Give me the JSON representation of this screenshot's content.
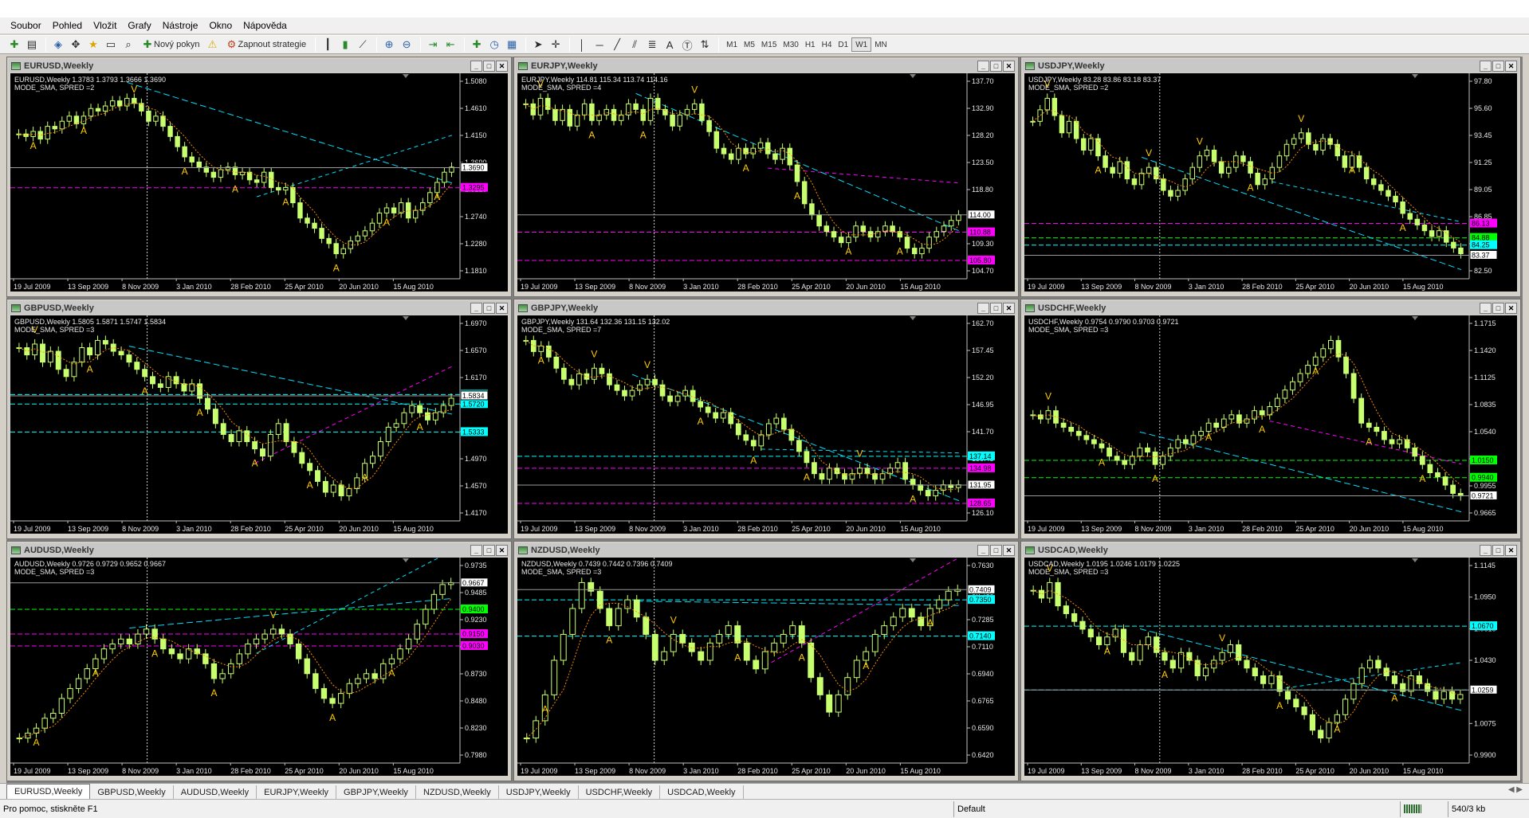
{
  "menu": [
    "Soubor",
    "Pohled",
    "Vložit",
    "Grafy",
    "Nástroje",
    "Okno",
    "Nápověda"
  ],
  "toolbar": {
    "new_order_label": "Nový pokyn",
    "strategy_label": "Zapnout strategie",
    "timeframes": [
      "M1",
      "M5",
      "M15",
      "M30",
      "H1",
      "H4",
      "D1",
      "W1",
      "MN"
    ],
    "active_timeframe": "W1"
  },
  "x_axis_dates": [
    "19 Jul 2009",
    "13 Sep 2009",
    "8 Nov 2009",
    "3 Jan 2010",
    "28 Feb 2010",
    "25 Apr 2010",
    "20 Jun 2010",
    "15 Aug 2010"
  ],
  "windows": [
    {
      "id": "eurusd",
      "title": "EURUSD,Weekly",
      "info1": "EURUSD,Weekly  1.3783 1.3793 1.3666 1.3690",
      "info2": "MODE_SMA, SPRED =2",
      "price_labels": [
        "1.5080",
        "1.4610",
        "1.4150",
        "1.3690",
        "1.3210",
        "1.2740",
        "1.2280",
        "1.1810"
      ],
      "current_price": "1.3690",
      "marker_labels": [
        "1.3295"
      ],
      "marker_colors": [
        "#ff00ff"
      ],
      "series": [
        1.435,
        1.43,
        1.44,
        1.425,
        1.45,
        1.445,
        1.46,
        1.47,
        1.455,
        1.47,
        1.485,
        1.48,
        1.49,
        1.5,
        1.49,
        1.505,
        1.495,
        1.48,
        1.46,
        1.47,
        1.45,
        1.43,
        1.41,
        1.39,
        1.38,
        1.37,
        1.36,
        1.35,
        1.365,
        1.37,
        1.355,
        1.36,
        1.345,
        1.34,
        1.36,
        1.33,
        1.325,
        1.33,
        1.3,
        1.27,
        1.26,
        1.25,
        1.23,
        1.22,
        1.2,
        1.21,
        1.225,
        1.235,
        1.245,
        1.26,
        1.28,
        1.29,
        1.28,
        1.3,
        1.27,
        1.285,
        1.3,
        1.32,
        1.34,
        1.36,
        1.37
      ]
    },
    {
      "id": "eurjpy",
      "title": "EURJPY,Weekly",
      "info1": "EURJPY,Weekly  114.81 115.34 113.74 114.16",
      "info2": "MODE_SMA, SPRED =4",
      "price_labels": [
        "137.70",
        "132.90",
        "128.20",
        "123.50",
        "118.80",
        "114.00",
        "109.30",
        "104.70"
      ],
      "current_price": "114.00",
      "marker_labels": [
        "110.88",
        "105.80"
      ],
      "marker_colors": [
        "#ff00ff",
        "#ff00ff"
      ],
      "series": [
        134,
        132,
        135,
        133,
        131,
        133,
        130,
        132,
        134,
        131,
        132,
        133,
        131,
        132,
        134,
        133,
        131,
        135,
        133,
        132,
        130,
        132,
        133,
        134,
        131,
        129,
        126,
        125,
        124,
        126,
        125,
        126,
        127,
        125,
        124,
        126,
        123,
        120,
        116,
        114,
        112,
        111,
        110,
        109,
        110,
        112,
        111,
        110,
        111,
        112,
        111,
        110,
        108,
        107,
        108,
        110,
        111,
        112,
        113,
        114
      ]
    },
    {
      "id": "usdjpy",
      "title": "USDJPY,Weekly",
      "info1": "USDJPY,Weekly  83.28 83.86 83.18 83.37",
      "info2": "MODE_SMA, SPRED =2",
      "price_labels": [
        "97.80",
        "95.60",
        "93.45",
        "91.25",
        "89.05",
        "86.85",
        "84.70",
        "82.50"
      ],
      "current_price": "83.37",
      "marker_labels": [
        "86.13",
        "84.88",
        "84.25"
      ],
      "marker_colors": [
        "#ff00ff",
        "#00ff00",
        "#00ffff"
      ],
      "series": [
        95,
        96,
        97,
        95.5,
        94,
        95,
        93.5,
        92.5,
        93.5,
        92,
        91,
        90.5,
        91.5,
        90,
        89.5,
        90.5,
        91,
        90,
        89,
        88.5,
        89,
        90,
        91,
        92,
        92.5,
        91.5,
        90.5,
        91,
        92,
        91.5,
        90.5,
        89.5,
        90,
        91,
        92,
        93,
        93.5,
        94,
        93,
        92.5,
        93.5,
        93,
        92,
        91,
        92,
        91,
        90,
        89.5,
        89,
        88.5,
        88,
        87,
        86.5,
        86,
        85.5,
        85,
        85.5,
        84.5,
        84,
        83.5
      ]
    },
    {
      "id": "gbpusd",
      "title": "GBPUSD,Weekly",
      "info1": "GBPUSD,Weekly  1.5805 1.5871 1.5747 1.5834",
      "info2": "MODE_SMA, SPRED =3",
      "price_labels": [
        "1.6970",
        "1.6570",
        "1.6170",
        "1.5770",
        "1.5370",
        "1.4970",
        "1.4570",
        "1.4170"
      ],
      "current_price": "1.5834",
      "marker_labels": [
        "1.5834",
        "1.5851",
        "1.5720",
        "1.5333"
      ],
      "marker_colors": [
        "#00ffff",
        "#00ffff",
        "#00ffff",
        "#00ffff"
      ],
      "series": [
        1.65,
        1.64,
        1.655,
        1.63,
        1.645,
        1.62,
        1.61,
        1.63,
        1.65,
        1.64,
        1.66,
        1.655,
        1.645,
        1.64,
        1.63,
        1.62,
        1.61,
        1.6,
        1.595,
        1.61,
        1.6,
        1.59,
        1.6,
        1.58,
        1.565,
        1.545,
        1.53,
        1.52,
        1.535,
        1.52,
        1.51,
        1.5,
        1.53,
        1.545,
        1.52,
        1.505,
        1.49,
        1.48,
        1.465,
        1.45,
        1.46,
        1.445,
        1.455,
        1.47,
        1.49,
        1.5,
        1.52,
        1.54,
        1.545,
        1.56,
        1.57,
        1.56,
        1.55,
        1.56,
        1.57,
        1.58
      ]
    },
    {
      "id": "gbpjpy",
      "title": "GBPJPY,Weekly",
      "info1": "GBPJPY,Weekly  131.64 132.36 131.15 132.02",
      "info2": "MODE_SMA, SPRED =7",
      "price_labels": [
        "162.70",
        "157.45",
        "152.20",
        "146.95",
        "141.70",
        "136.45",
        "131.20",
        "126.10"
      ],
      "current_price": "131.95",
      "marker_labels": [
        "137.14",
        "134.98",
        "131.95",
        "128.65"
      ],
      "marker_colors": [
        "#00ffff",
        "#ff00ff",
        "#00ffff",
        "#ff00ff"
      ],
      "series": [
        158,
        156,
        157,
        155,
        153,
        151,
        150,
        152,
        151,
        153,
        152,
        150,
        149,
        148,
        149,
        150,
        151,
        150,
        148,
        147,
        148,
        149,
        147,
        146,
        145,
        144,
        145,
        143,
        141,
        140,
        139,
        141,
        143,
        144,
        142,
        140,
        138,
        136,
        134,
        133,
        135,
        134,
        133,
        134,
        135,
        134,
        133,
        134,
        135,
        136,
        133,
        132,
        131,
        130,
        131,
        132,
        131.5,
        132
      ]
    },
    {
      "id": "usdchf",
      "title": "USDCHF,Weekly",
      "info1": "USDCHF,Weekly  0.9754 0.9790 0.9703 0.9721",
      "info2": "MODE_SMA, SPRED =3",
      "price_labels": [
        "1.1715",
        "1.1420",
        "1.1125",
        "1.0835",
        "1.0540",
        "1.0250",
        "0.9955",
        "0.9665"
      ],
      "current_price": "0.9721",
      "marker_labels": [
        "1.0150",
        "0.9940"
      ],
      "marker_colors": [
        "#00ff00",
        "#00ff00"
      ],
      "series": [
        1.07,
        1.065,
        1.075,
        1.06,
        1.055,
        1.05,
        1.045,
        1.04,
        1.035,
        1.03,
        1.02,
        1.015,
        1.01,
        1.02,
        1.03,
        1.025,
        1.01,
        1.02,
        1.03,
        1.04,
        1.035,
        1.045,
        1.05,
        1.06,
        1.055,
        1.065,
        1.07,
        1.06,
        1.065,
        1.075,
        1.07,
        1.08,
        1.09,
        1.1,
        1.11,
        1.12,
        1.13,
        1.14,
        1.15,
        1.16,
        1.14,
        1.12,
        1.09,
        1.06,
        1.055,
        1.05,
        1.04,
        1.035,
        1.04,
        1.03,
        1.02,
        1.01,
        1.0,
        0.995,
        0.985,
        0.975,
        0.972
      ]
    },
    {
      "id": "audusd",
      "title": "AUDUSD,Weekly",
      "info1": "AUDUSD,Weekly  0.9726 0.9729 0.9652 0.9667",
      "info2": "MODE_SMA, SPRED =3",
      "price_labels": [
        "0.9735",
        "0.9485",
        "0.9230",
        "0.8980",
        "0.8730",
        "0.8480",
        "0.8230",
        "0.7980"
      ],
      "current_price": "0.9667",
      "marker_labels": [
        "0.9400",
        "0.9150",
        "0.9030"
      ],
      "marker_colors": [
        "#00ff00",
        "#ff00ff",
        "#ff00ff"
      ],
      "series": [
        0.81,
        0.815,
        0.82,
        0.83,
        0.835,
        0.85,
        0.86,
        0.87,
        0.88,
        0.89,
        0.9,
        0.905,
        0.91,
        0.905,
        0.915,
        0.92,
        0.91,
        0.9,
        0.895,
        0.89,
        0.9,
        0.895,
        0.885,
        0.87,
        0.875,
        0.885,
        0.895,
        0.905,
        0.91,
        0.915,
        0.92,
        0.915,
        0.905,
        0.89,
        0.875,
        0.86,
        0.85,
        0.845,
        0.855,
        0.865,
        0.87,
        0.875,
        0.87,
        0.885,
        0.89,
        0.9,
        0.91,
        0.925,
        0.94,
        0.955,
        0.965,
        0.967
      ]
    },
    {
      "id": "nzdusd",
      "title": "NZDUSD,Weekly",
      "info1": "NZDUSD,Weekly  0.7439 0.7442 0.7396 0.7409",
      "info2": "MODE_SMA, SPRED =3",
      "price_labels": [
        "0.7630",
        "0.7460",
        "0.7285",
        "0.7110",
        "0.6940",
        "0.6765",
        "0.6590",
        "0.6420"
      ],
      "current_price": "0.7409",
      "marker_labels": [
        "0.7350",
        "0.7140"
      ],
      "marker_colors": [
        "#00ffff",
        "#00ffff"
      ],
      "series": [
        0.655,
        0.665,
        0.68,
        0.7,
        0.715,
        0.73,
        0.745,
        0.74,
        0.73,
        0.72,
        0.73,
        0.735,
        0.725,
        0.715,
        0.7,
        0.705,
        0.715,
        0.71,
        0.705,
        0.7,
        0.71,
        0.715,
        0.72,
        0.71,
        0.7,
        0.695,
        0.705,
        0.71,
        0.715,
        0.72,
        0.71,
        0.69,
        0.68,
        0.67,
        0.68,
        0.69,
        0.7,
        0.705,
        0.715,
        0.72,
        0.725,
        0.73,
        0.725,
        0.72,
        0.73,
        0.735,
        0.74,
        0.741
      ]
    },
    {
      "id": "usdcad",
      "title": "USDCAD,Weekly",
      "info1": "USDCAD,Weekly  1.0195 1.0246 1.0179 1.0225",
      "info2": "MODE_SMA, SPRED =3",
      "price_labels": [
        "1.1145",
        "1.0950",
        "1.0610",
        "1.0430",
        "1.0250",
        "1.0075",
        "0.9900"
      ],
      "current_price": "1.0259",
      "marker_labels": [
        "1.0670",
        "1.0259"
      ],
      "marker_colors": [
        "#00ffff",
        "#00ffff"
      ],
      "series": [
        1.09,
        1.085,
        1.095,
        1.08,
        1.075,
        1.07,
        1.065,
        1.06,
        1.055,
        1.06,
        1.065,
        1.05,
        1.045,
        1.055,
        1.06,
        1.05,
        1.045,
        1.04,
        1.05,
        1.045,
        1.035,
        1.04,
        1.045,
        1.05,
        1.055,
        1.045,
        1.04,
        1.035,
        1.03,
        1.035,
        1.025,
        1.02,
        1.015,
        1.01,
        1.0,
        0.995,
        1.005,
        1.01,
        1.02,
        1.03,
        1.04,
        1.045,
        1.04,
        1.035,
        1.03,
        1.025,
        1.035,
        1.03,
        1.025,
        1.02,
        1.025,
        1.02,
        1.023
      ]
    }
  ],
  "tabs": [
    "EURUSD,Weekly",
    "GBPUSD,Weekly",
    "AUDUSD,Weekly",
    "EURJPY,Weekly",
    "GBPJPY,Weekly",
    "NZDUSD,Weekly",
    "USDJPY,Weekly",
    "USDCHF,Weekly",
    "USDCAD,Weekly"
  ],
  "active_tab": "EURUSD,Weekly",
  "statusbar": {
    "help_text": "Pro pomoc, stiskněte F1",
    "profile": "Default",
    "traffic": "540/3 kb"
  },
  "colors": {
    "candle": "#c8ff6e",
    "chart_bg": "#000000",
    "fractal": "#ffcc00",
    "ma": "#ff8c00",
    "cyan_line": "#00e0ff",
    "magenta_line": "#ff00ff",
    "green_line": "#00ff00"
  }
}
